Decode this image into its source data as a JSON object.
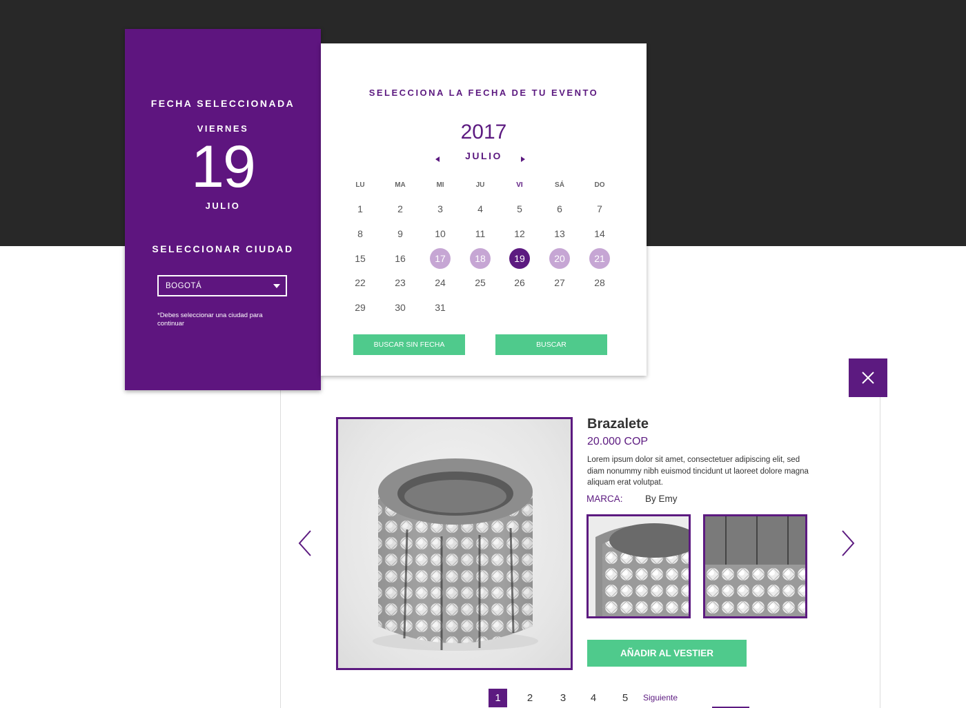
{
  "left_panel": {
    "selected_date_heading": "FECHA SELECCIONADA",
    "weekday": "VIERNES",
    "day_number": "19",
    "month": "JULIO",
    "city_heading": "SELECCIONAR CIUDAD",
    "city_select": {
      "value": "BOGOTÁ"
    },
    "city_note": "*Debes seleccionar una ciudad para continuar"
  },
  "calendar": {
    "heading": "SELECCIONA LA FECHA DE TU EVENTO",
    "year": "2017",
    "month": "JULIO",
    "weekdays": [
      "LU",
      "MA",
      "MI",
      "JU",
      "VI",
      "SÁ",
      "DO"
    ],
    "weeks": [
      [
        "1",
        "2",
        "3",
        "4",
        "5",
        "6",
        "7"
      ],
      [
        "8",
        "9",
        "10",
        "11",
        "12",
        "13",
        "14"
      ],
      [
        "15",
        "16",
        "17",
        "18",
        "19",
        "20",
        "21"
      ],
      [
        "22",
        "23",
        "24",
        "25",
        "26",
        "27",
        "28"
      ],
      [
        "29",
        "30",
        "31"
      ]
    ],
    "range_days": [
      "17",
      "18",
      "20",
      "21"
    ],
    "selected_day": "19",
    "buttons": {
      "no_date": "BUSCAR SIN FECHA",
      "search": "BUSCAR"
    }
  },
  "product": {
    "title": "Brazalete",
    "price": "20.000 COP",
    "description": "Lorem ipsum dolor sit amet, consectetuer adipiscing elit, sed diam nonummy nibh euismod tincidunt ut laoreet dolore magna aliquam erat volutpat.",
    "brand_label": "MARCA:",
    "brand_value": "By Emy",
    "add_button": "AÑADIR AL VESTIER"
  },
  "pagination": {
    "pages": [
      "1",
      "2",
      "3",
      "4",
      "5"
    ],
    "current": "1",
    "next_label": "Siguiente"
  },
  "icons": {
    "close": "close-icon",
    "prev": "chevron-left-icon",
    "next": "chevron-right-icon",
    "month_prev": "caret-left-icon",
    "month_next": "caret-right-icon",
    "dropdown": "caret-down-icon"
  },
  "colors": {
    "brand_purple": "#5e157f",
    "accent_green": "#4fca8c",
    "range_lilac": "#c6a6d4",
    "dark_band": "#282828"
  }
}
